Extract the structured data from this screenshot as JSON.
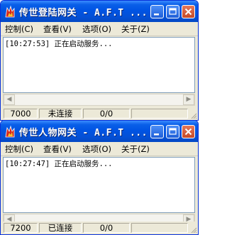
{
  "windows": [
    {
      "title": "传世登陆网关 - A.F.T ...",
      "menu": [
        "控制(C)",
        "查看(V)",
        "选项(O)",
        "关于(Z)"
      ],
      "log": "[10:27:53] 正在启动服务...",
      "status": {
        "port": "7000",
        "connection": "未连接",
        "count": "0/0"
      }
    },
    {
      "title": "传世人物网关 - A.F.T ...",
      "menu": [
        "控制(C)",
        "查看(V)",
        "选项(O)",
        "关于(Z)"
      ],
      "log": "[10:27:47] 正在启动服务...",
      "status": {
        "port": "7200",
        "connection": "已连接",
        "count": "0/0"
      }
    }
  ],
  "icons": {
    "app": "flame-app-icon",
    "minimize": "minimize-icon",
    "maximize": "maximize-icon",
    "close": "close-icon"
  }
}
